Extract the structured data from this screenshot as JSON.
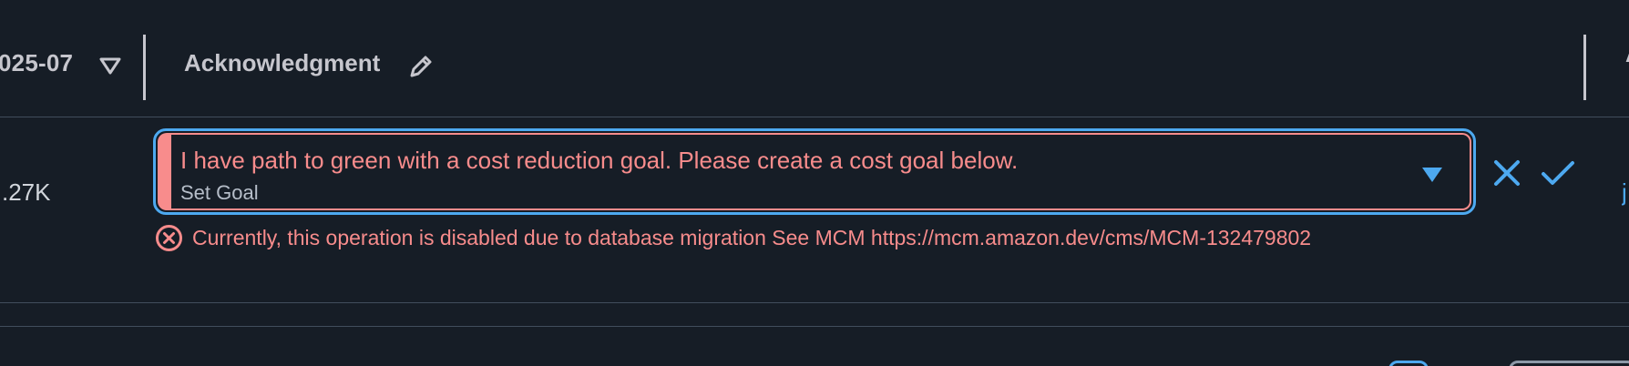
{
  "header": {
    "date_column_label": "025-07",
    "sort_icon": "caret-down-outline-icon",
    "ack_column_label": "Acknowledgment",
    "edit_icon": "pencil-icon",
    "next_column_label": "A"
  },
  "row": {
    "value": ".27K",
    "ack_select": {
      "value": "I have path to green with a cost reduction goal. Please create a cost goal below.",
      "secondary": "Set Goal"
    },
    "next_link": "j",
    "error": "Currently, this operation is disabled due to database migration See MCM https://mcm.amazon.dev/cms/MCM-132479802"
  },
  "colors": {
    "background": "#161d26",
    "accent": "#4da9f0",
    "error": "#f88c8c",
    "header_text": "#c6c6cd",
    "divider": "#414d5c"
  }
}
